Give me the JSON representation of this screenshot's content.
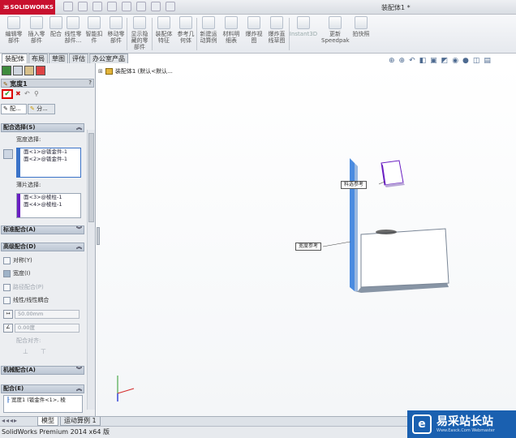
{
  "app": {
    "logo_text": "SOLIDWORKS",
    "doc_title": "装配体1 *"
  },
  "ribbon": {
    "buttons": [
      {
        "label": "编辑零\n部件",
        "icon": "edit-component-icon"
      },
      {
        "label": "插入零\n部件",
        "icon": "insert-component-icon"
      },
      {
        "label": "配合",
        "icon": "mate-icon"
      },
      {
        "label": "线性零\n部件...",
        "icon": "linear-pattern-icon"
      },
      {
        "label": "智能扣\n件",
        "icon": "smart-fastener-icon"
      },
      {
        "label": "移动零\n部件",
        "icon": "move-component-icon"
      },
      {
        "label": "显示隐\n藏的零\n部件",
        "icon": "show-hidden-icon"
      },
      {
        "label": "装配体\n特征",
        "icon": "assembly-feature-icon"
      },
      {
        "label": "参考几\n何体",
        "icon": "reference-geometry-icon"
      },
      {
        "label": "新建运\n动算例",
        "icon": "motion-study-icon"
      },
      {
        "label": "材料明\n细表",
        "icon": "bom-icon"
      },
      {
        "label": "爆炸视\n图",
        "icon": "exploded-view-icon"
      },
      {
        "label": "爆炸直\n线草图",
        "icon": "explode-line-icon"
      },
      {
        "label": "Instant3D",
        "icon": "instant3d-icon"
      },
      {
        "label": "更新\nSpeedpak",
        "icon": "speedpak-icon"
      },
      {
        "label": "拍快照",
        "icon": "snapshot-icon"
      }
    ]
  },
  "tabs": [
    "装配体",
    "布局",
    "草图",
    "评估",
    "办公室产品"
  ],
  "panel": {
    "title": "宽度1",
    "tab_mates": "配...",
    "tab_analysis": "分...",
    "section_selection": "配合选择(S)",
    "width_selection_label": "宽度选择:",
    "width_items": [
      "面<1>@钣金件-1",
      "面<2>@钣金件-1"
    ],
    "tab_selection_label": "薄片选择:",
    "tab_items": [
      "面<3>@棱柱-1",
      "面<4>@棱柱-1"
    ],
    "section_standard": "标准配合(A)",
    "section_advanced": "高级配合(D)",
    "opt_symmetric": "对称(Y)",
    "opt_width": "宽度(I)",
    "opt_path": "路径配合(P)",
    "opt_linear": "线性/线性耦合",
    "distance_value": "50.00mm",
    "angle_value": "0.00度",
    "mate_align": "配合对齐:",
    "section_mechanical": "机械配合(A)",
    "section_mates": "配合(E)",
    "mate_entry": "宽度1 (钣金件<1>, 棱"
  },
  "tree": {
    "root": "装配体1 (默认<默认..."
  },
  "callouts": {
    "tab_ref": "料选参考",
    "width_ref": "宽度参考"
  },
  "bottom_tabs": [
    "模型",
    "运动算例 1"
  ],
  "status": {
    "text": "SolidWorks Premium 2014 x64 版"
  },
  "watermark": {
    "text": "易采站长站",
    "sub": "Www.Easck.Com Webmaster"
  },
  "colors": {
    "accent_blue": "#3b73c8",
    "purple": "#6a1fc2",
    "ok_green": "#2e9e2e",
    "cancel_red": "#cc1a1a"
  }
}
